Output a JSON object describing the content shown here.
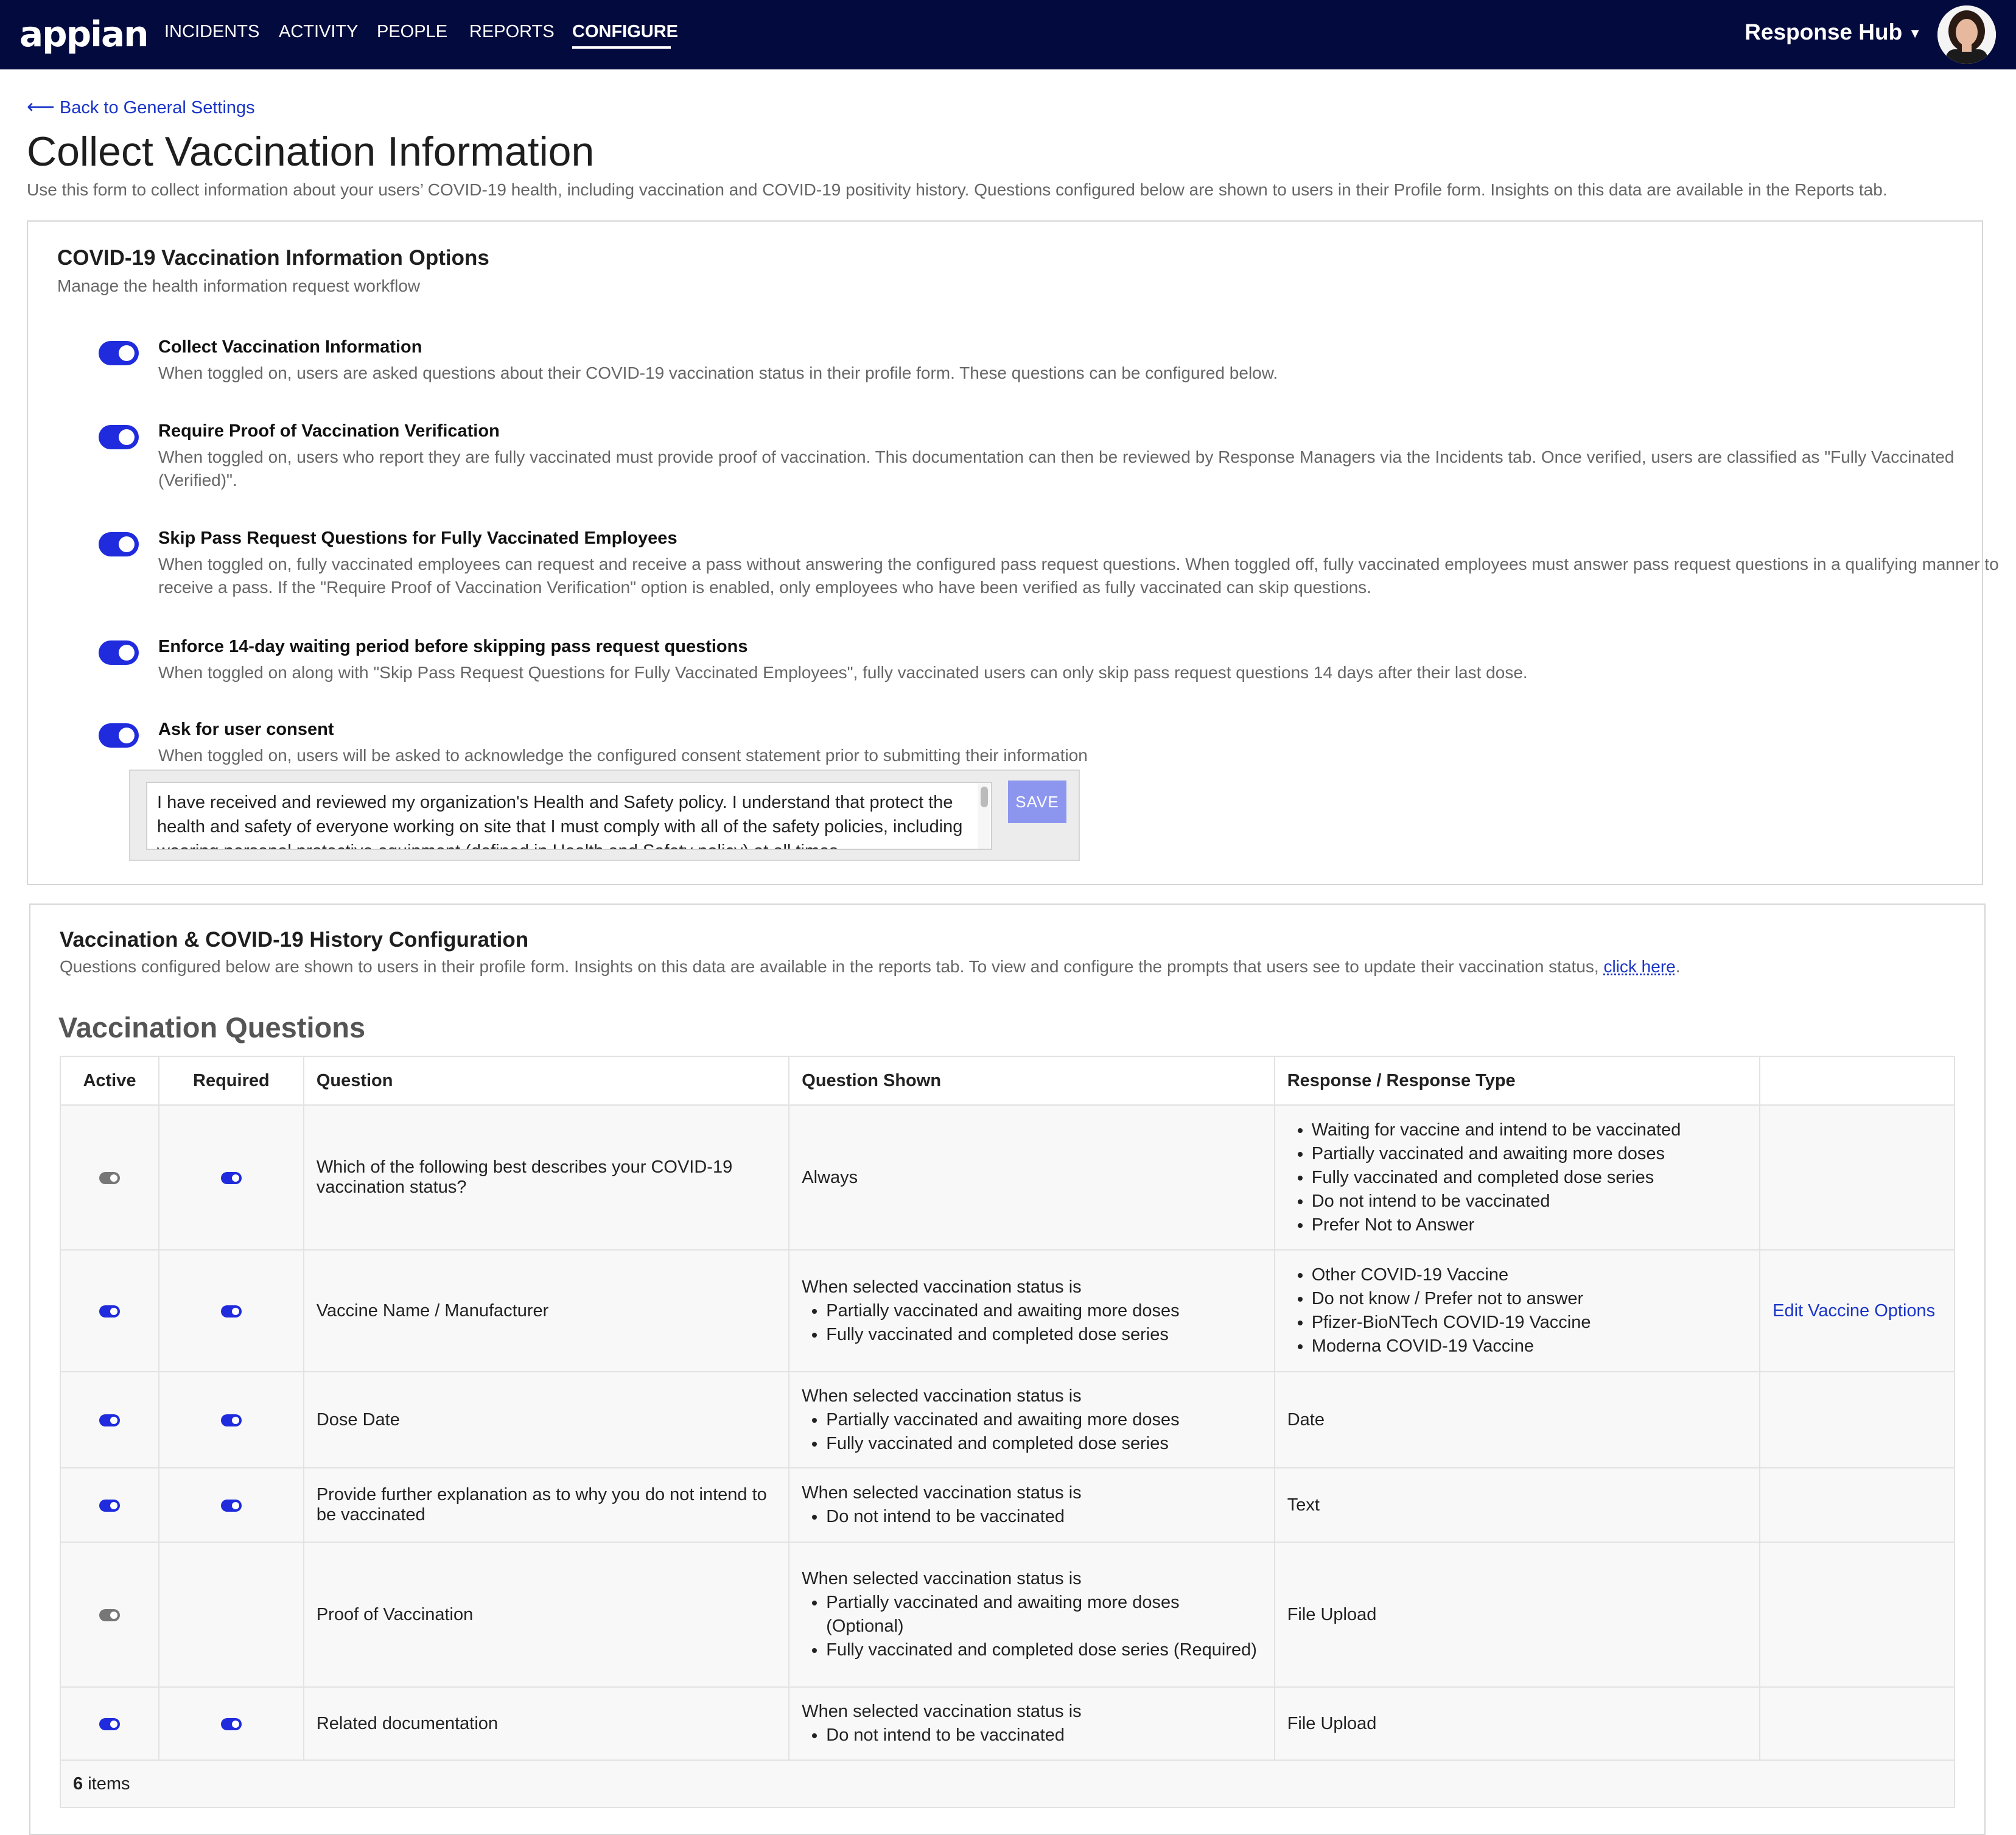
{
  "app": {
    "logo": "appian",
    "nav": [
      "INCIDENTS",
      "ACTIVITY",
      "PEOPLE",
      "REPORTS",
      "CONFIGURE"
    ],
    "active_nav": "CONFIGURE",
    "hub_label": "Response Hub"
  },
  "page": {
    "back_link": "Back to General Settings",
    "title": "Collect Vaccination Information",
    "intro": "Use this form to collect information about your users’ COVID-19 health, including vaccination and COVID-19 positivity history. Questions configured below are shown to users in their Profile form. Insights on this data are available in the Reports tab."
  },
  "options_card": {
    "title": "COVID-19 Vaccination Information Options",
    "subtitle": "Manage the health information request workflow",
    "options": [
      {
        "title": "Collect Vaccination Information",
        "desc": "When toggled on, users are asked questions about their COVID-19 vaccination status in their profile form. These questions can be configured below.",
        "on": true
      },
      {
        "title": "Require Proof of Vaccination Verification",
        "desc": "When toggled on, users who report they are fully vaccinated must provide proof of vaccination. This documentation can then be reviewed by Response Managers via the Incidents tab. Once verified, users are classified as \"Fully Vaccinated (Verified)\".",
        "on": true
      },
      {
        "title": "Skip Pass Request Questions for Fully Vaccinated Employees",
        "desc": "When toggled on, fully vaccinated employees can request and receive a pass without answering the configured pass request questions. When toggled off, fully vaccinated employees must answer pass request questions in a qualifying manner to receive a pass. If the \"Require Proof of Vaccination Verification\" option is enabled, only employees who have been verified as fully vaccinated can skip questions.",
        "on": true
      },
      {
        "title": "Enforce 14-day waiting period before skipping pass request questions",
        "desc": "When toggled on along with \"Skip Pass Request Questions for Fully Vaccinated Employees\", fully vaccinated users can only skip pass request questions 14 days after their last dose.",
        "on": true
      },
      {
        "title": "Ask for user consent",
        "desc": "When toggled on, users will be asked to acknowledge the configured consent statement prior to submitting their information",
        "on": true
      }
    ],
    "consent_text": "I have received and reviewed my organization's Health and Safety policy. I understand that protect the health and safety of everyone working on site that I must comply with all of the safety policies, including wearing personal protective equipment (defined in Health and Safety policy) at all times.",
    "save_label": "SAVE"
  },
  "history_card": {
    "title": "Vaccination & COVID-19 History Configuration",
    "subtitle_text": "Questions configured below are shown to users in their profile form. Insights on this data are available in the reports tab. To view and configure the prompts that users see to update their vaccination status,",
    "subtitle_link": "click here",
    "section_title": "Vaccination Questions",
    "columns": [
      "Active",
      "Required",
      "Question",
      "Question Shown",
      "Response / Response Type",
      ""
    ],
    "cond_label": "When selected vaccination status is",
    "rows": [
      {
        "active": false,
        "required": true,
        "question": "Which of the following best describes your COVID-19 vaccination status?",
        "shown": "Always",
        "responses": [
          "Waiting for vaccine and intend to be vaccinated",
          "Partially vaccinated and awaiting more doses",
          "Fully vaccinated and completed dose series",
          "Do not intend to be vaccinated",
          "Prefer Not to Answer"
        ]
      },
      {
        "active": true,
        "required": true,
        "question": "Vaccine Name / Manufacturer",
        "conditions": [
          "Partially vaccinated and awaiting more doses",
          "Fully vaccinated and completed dose series"
        ],
        "responses": [
          "Other COVID-19 Vaccine",
          "Do not know / Prefer not to answer",
          "Pfizer-BioNTech COVID-19 Vaccine",
          "Moderna COVID-19 Vaccine"
        ],
        "action": "Edit Vaccine Options"
      },
      {
        "active": true,
        "required": true,
        "question": "Dose Date",
        "conditions": [
          "Partially vaccinated and awaiting more doses",
          "Fully vaccinated and completed dose series"
        ],
        "response_type": "Date"
      },
      {
        "active": true,
        "required": true,
        "question": "Provide further explanation as to why you do not intend to be vaccinated",
        "conditions": [
          "Do not intend to be vaccinated"
        ],
        "response_type": "Text"
      },
      {
        "active": false,
        "required": null,
        "question": "Proof of Vaccination",
        "conditions": [
          "Partially vaccinated and awaiting more doses (Optional)",
          "Fully vaccinated and completed dose series (Required)"
        ],
        "response_type": "File Upload"
      },
      {
        "active": true,
        "required": true,
        "question": "Related documentation",
        "conditions": [
          "Do not intend to be vaccinated"
        ],
        "response_type": "File Upload"
      }
    ],
    "items_count": "6",
    "items_label": "items"
  },
  "colors": {
    "header_bg": "#030a3e",
    "toggle_on": "#1f2bdc",
    "link": "#1a34c8",
    "save_btn": "#8d96ef"
  }
}
